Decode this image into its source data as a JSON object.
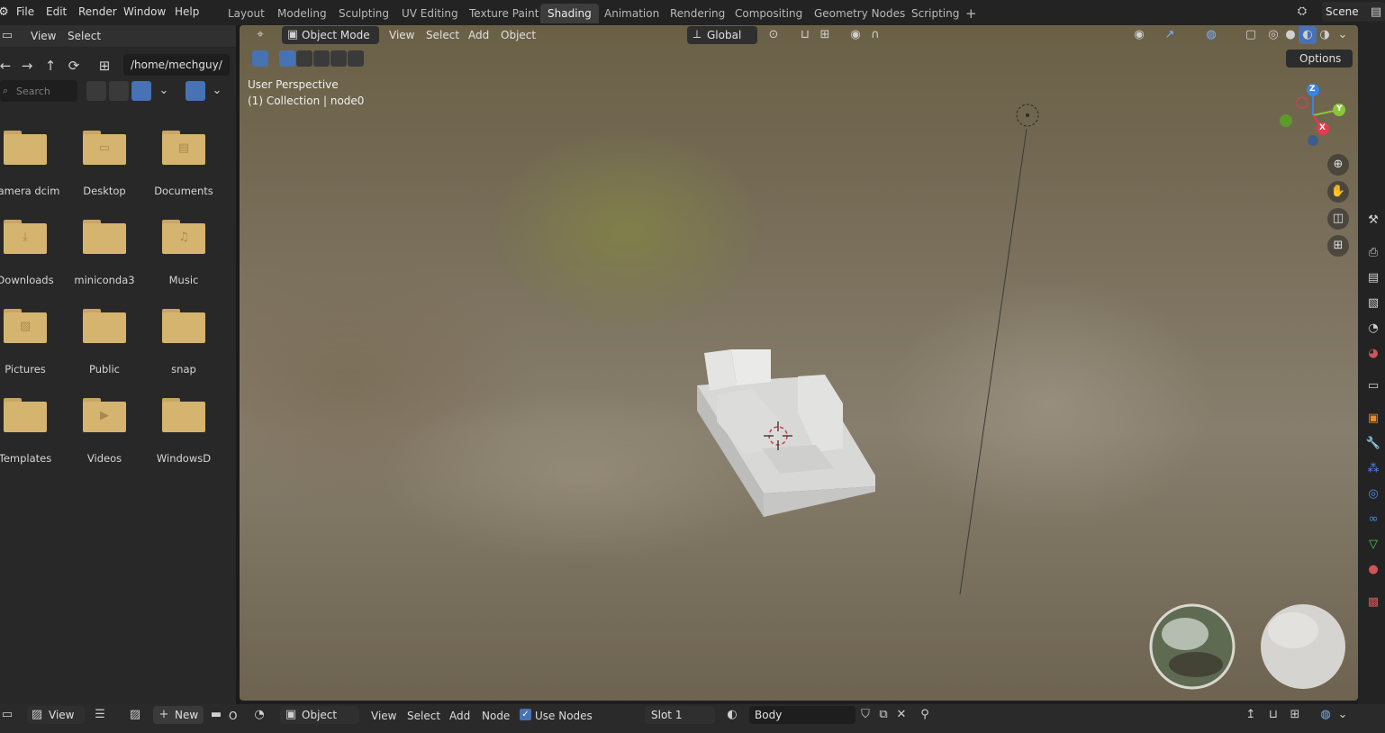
{
  "topbar": {
    "menus": [
      "File",
      "Edit",
      "Render",
      "Window",
      "Help"
    ],
    "workspaces": [
      "Layout",
      "Modeling",
      "Sculpting",
      "UV Editing",
      "Texture Paint",
      "Shading",
      "Animation",
      "Rendering",
      "Compositing",
      "Geometry Nodes",
      "Scripting"
    ],
    "active_workspace": "Shading",
    "add_tab_label": "+",
    "scene_name": "Scene"
  },
  "file_browser": {
    "menus": [
      "View",
      "Select"
    ],
    "path": "/home/mechguy/",
    "search_placeholder": "Search",
    "folders": [
      {
        "label": "Camera dcim",
        "icon": "folder-icon"
      },
      {
        "label": "Desktop",
        "icon": "desktop-folder-icon"
      },
      {
        "label": "Documents",
        "icon": "documents-folder-icon"
      },
      {
        "label": "Downloads",
        "icon": "downloads-folder-icon"
      },
      {
        "label": "miniconda3",
        "icon": "folder-icon"
      },
      {
        "label": "Music",
        "icon": "music-folder-icon"
      },
      {
        "label": "Pictures",
        "icon": "pictures-folder-icon"
      },
      {
        "label": "Public",
        "icon": "folder-icon"
      },
      {
        "label": "snap",
        "icon": "folder-icon"
      },
      {
        "label": "Templates",
        "icon": "folder-icon"
      },
      {
        "label": "Videos",
        "icon": "videos-folder-icon"
      },
      {
        "label": "WindowsD",
        "icon": "folder-icon"
      }
    ]
  },
  "viewport": {
    "mode": "Object Mode",
    "menus": [
      "View",
      "Select",
      "Add",
      "Object"
    ],
    "transform_orientation": "Global",
    "options_label": "Options",
    "info_line_1": "User Perspective",
    "info_line_2": "(1) Collection | node0",
    "gizmo_axes": {
      "x": "X",
      "y": "Y",
      "z": "Z"
    }
  },
  "bottombar": {
    "view_label": "View",
    "new_label": "New",
    "object_label": "Object",
    "menus": [
      "View",
      "Select",
      "Add",
      "Node"
    ],
    "use_nodes_label": "Use Nodes",
    "use_nodes_checked": true,
    "slot": "Slot 1",
    "material_name": "Body",
    "truncated_label": "O"
  },
  "colors": {
    "accent": "#4772b3",
    "folder": "#d4b46f",
    "axis_x": "#e8394f",
    "axis_y": "#8cc43a",
    "axis_z": "#3c82e8"
  }
}
